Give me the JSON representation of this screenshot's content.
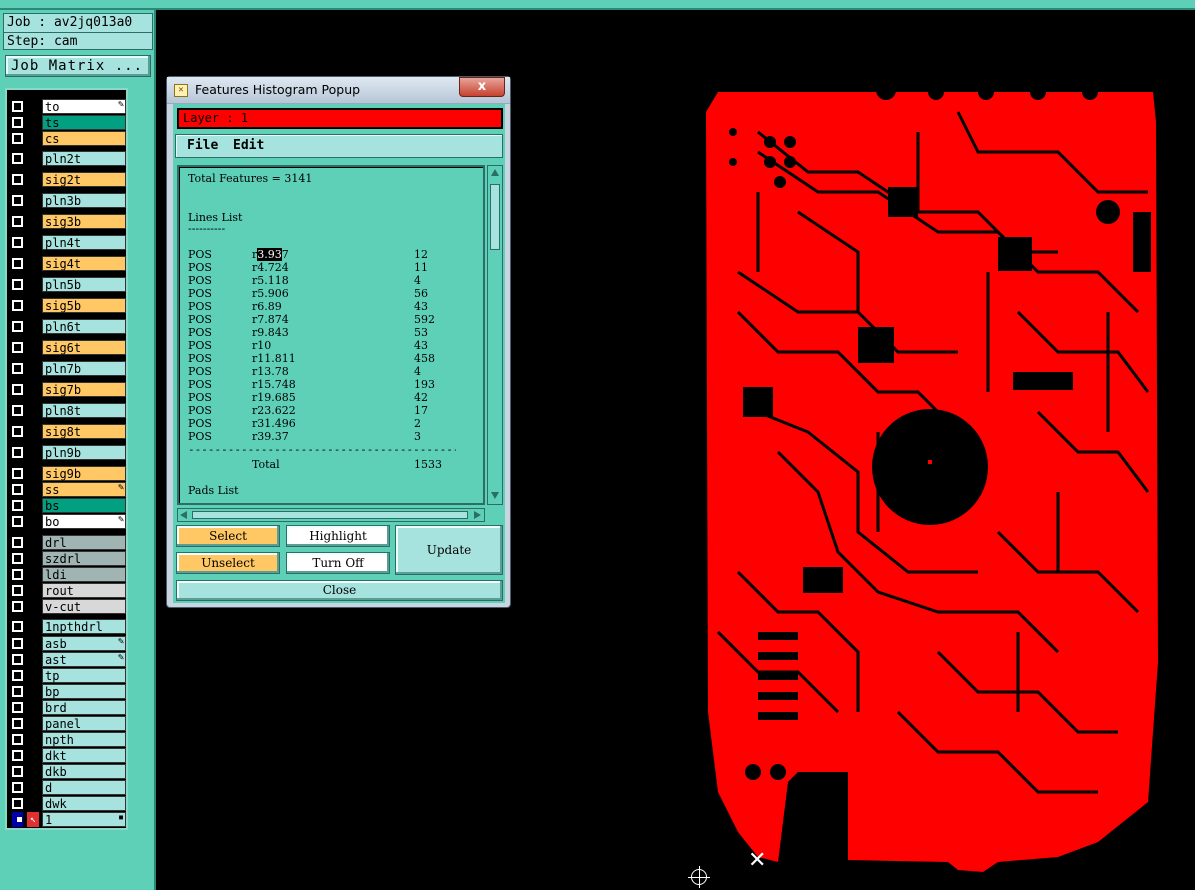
{
  "job": {
    "job_line": "Job : av2jq013a0",
    "step_line": "Step: cam",
    "matrix_button": "Job Matrix ..."
  },
  "layers": [
    {
      "name": "to",
      "color": "#ffffff",
      "mark": "✎"
    },
    {
      "name": "ts",
      "color": "#00a080",
      "mark": ""
    },
    {
      "name": "cs",
      "color": "#ffc864",
      "mark": ""
    },
    {
      "name": "pln2t",
      "color": "#a6e2de",
      "mark": ""
    },
    {
      "name": "sig2t",
      "color": "#ffc864",
      "mark": ""
    },
    {
      "name": "pln3b",
      "color": "#a6e2de",
      "mark": ""
    },
    {
      "name": "sig3b",
      "color": "#ffc864",
      "mark": ""
    },
    {
      "name": "pln4t",
      "color": "#a6e2de",
      "mark": ""
    },
    {
      "name": "sig4t",
      "color": "#ffc864",
      "mark": ""
    },
    {
      "name": "pln5b",
      "color": "#a6e2de",
      "mark": ""
    },
    {
      "name": "sig5b",
      "color": "#ffc864",
      "mark": ""
    },
    {
      "name": "pln6t",
      "color": "#a6e2de",
      "mark": ""
    },
    {
      "name": "sig6t",
      "color": "#ffc864",
      "mark": ""
    },
    {
      "name": "pln7b",
      "color": "#a6e2de",
      "mark": ""
    },
    {
      "name": "sig7b",
      "color": "#ffc864",
      "mark": ""
    },
    {
      "name": "pln8t",
      "color": "#a6e2de",
      "mark": ""
    },
    {
      "name": "sig8t",
      "color": "#ffc864",
      "mark": ""
    },
    {
      "name": "pln9b",
      "color": "#a6e2de",
      "mark": ""
    },
    {
      "name": "sig9b",
      "color": "#ffc864",
      "mark": ""
    },
    {
      "name": "ss",
      "color": "#ffc864",
      "mark": "✎"
    },
    {
      "name": "bs",
      "color": "#00a080",
      "mark": ""
    },
    {
      "name": "bo",
      "color": "#ffffff",
      "mark": "✎"
    },
    {
      "name": "drl",
      "color": "#a0b4b4",
      "mark": ""
    },
    {
      "name": "szdrl",
      "color": "#a0b4b4",
      "mark": ""
    },
    {
      "name": "ldi",
      "color": "#a0b4b4",
      "mark": ""
    },
    {
      "name": "rout",
      "color": "#d8d8d8",
      "mark": ""
    },
    {
      "name": "v-cut",
      "color": "#d8d8d8",
      "mark": ""
    },
    {
      "name": "1npthdrl",
      "color": "#a6e2de",
      "mark": ""
    },
    {
      "name": "asb",
      "color": "#a6e2de",
      "mark": "✎"
    },
    {
      "name": "ast",
      "color": "#a6e2de",
      "mark": "✎"
    },
    {
      "name": "tp",
      "color": "#a6e2de",
      "mark": ""
    },
    {
      "name": "bp",
      "color": "#a6e2de",
      "mark": ""
    },
    {
      "name": "brd",
      "color": "#a6e2de",
      "mark": ""
    },
    {
      "name": "panel",
      "color": "#a6e2de",
      "mark": ""
    },
    {
      "name": "npth",
      "color": "#a6e2de",
      "mark": ""
    },
    {
      "name": "dkt",
      "color": "#a6e2de",
      "mark": ""
    },
    {
      "name": "dkb",
      "color": "#a6e2de",
      "mark": ""
    },
    {
      "name": "d",
      "color": "#a6e2de",
      "mark": ""
    },
    {
      "name": "dwk",
      "color": "#a6e2de",
      "mark": ""
    },
    {
      "name": "1",
      "color": "#a6e2de",
      "mark": "▪"
    }
  ],
  "popup": {
    "title": "Features Histogram Popup",
    "close_glyph": "x",
    "layer_label": "Layer :  1",
    "menu": {
      "file": "File",
      "edit": "Edit"
    },
    "total_features": "Total Features = 3141",
    "lines_heading": "Lines List",
    "heading_underline": "----------",
    "rows": [
      {
        "pol": "POS",
        "sym_pre": "r",
        "sym_sel": "3.93",
        "sym_post": "7",
        "count": "12"
      },
      {
        "pol": "POS",
        "sym_pre": "r4.724",
        "sym_sel": "",
        "sym_post": "",
        "count": "11"
      },
      {
        "pol": "POS",
        "sym_pre": "r5.118",
        "sym_sel": "",
        "sym_post": "",
        "count": "4"
      },
      {
        "pol": "POS",
        "sym_pre": "r5.906",
        "sym_sel": "",
        "sym_post": "",
        "count": "56"
      },
      {
        "pol": "POS",
        "sym_pre": "r6.89",
        "sym_sel": "",
        "sym_post": "",
        "count": "43"
      },
      {
        "pol": "POS",
        "sym_pre": "r7.874",
        "sym_sel": "",
        "sym_post": "",
        "count": "592"
      },
      {
        "pol": "POS",
        "sym_pre": "r9.843",
        "sym_sel": "",
        "sym_post": "",
        "count": "53"
      },
      {
        "pol": "POS",
        "sym_pre": "r10",
        "sym_sel": "",
        "sym_post": "",
        "count": "43"
      },
      {
        "pol": "POS",
        "sym_pre": "r11.811",
        "sym_sel": "",
        "sym_post": "",
        "count": "458"
      },
      {
        "pol": "POS",
        "sym_pre": "r13.78",
        "sym_sel": "",
        "sym_post": "",
        "count": "4"
      },
      {
        "pol": "POS",
        "sym_pre": "r15.748",
        "sym_sel": "",
        "sym_post": "",
        "count": "193"
      },
      {
        "pol": "POS",
        "sym_pre": "r19.685",
        "sym_sel": "",
        "sym_post": "",
        "count": "42"
      },
      {
        "pol": "POS",
        "sym_pre": "r23.622",
        "sym_sel": "",
        "sym_post": "",
        "count": "17"
      },
      {
        "pol": "POS",
        "sym_pre": "r31.496",
        "sym_sel": "",
        "sym_post": "",
        "count": "2"
      },
      {
        "pol": "POS",
        "sym_pre": "r39.37",
        "sym_sel": "",
        "sym_post": "",
        "count": "3"
      }
    ],
    "separator": "--------------------------------------------------",
    "total_label": "Total",
    "total_value": "1533",
    "pads_heading": "Pads List",
    "buttons": {
      "select": "Select",
      "highlight": "Highlight",
      "update": "Update",
      "unselect": "Unselect",
      "turn_off": "Turn Off",
      "close": "Close"
    }
  },
  "colors": {
    "panel_bg": "#5fd0b8",
    "board_red": "#ff0000",
    "canvas_bg": "#000000"
  }
}
